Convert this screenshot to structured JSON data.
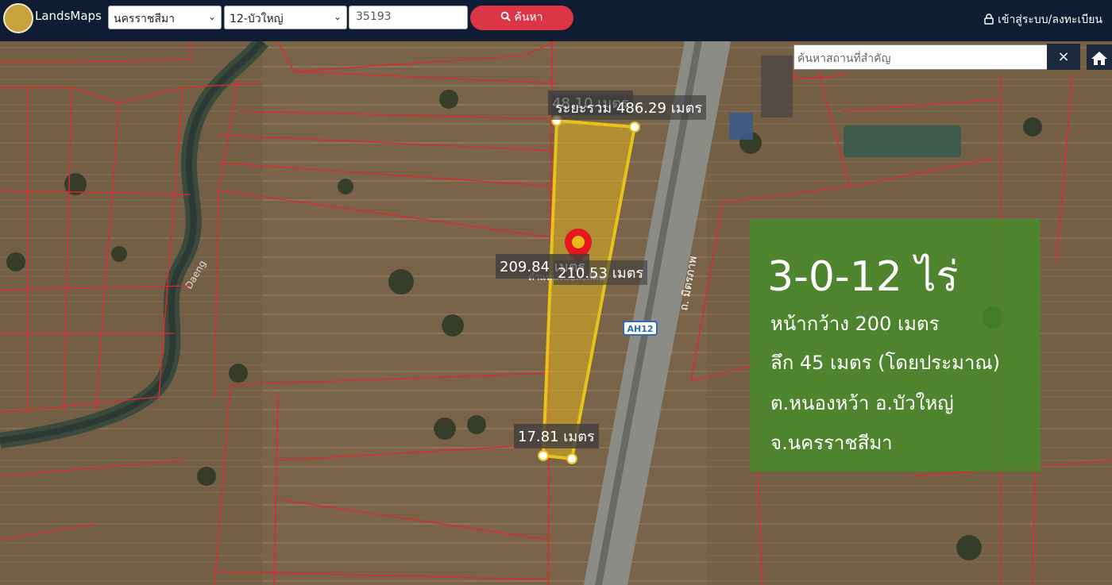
{
  "header": {
    "brand": "LandsMaps",
    "province": "นครราชสีมา",
    "district": "12-บัวใหญ่",
    "parcel_number": "35193",
    "search_label": "ค้นหา",
    "login_label": "เข้าสู่ระบบ/ลงทะเบียน"
  },
  "map": {
    "place_search_placeholder": "ค้นหาสถานที่สำคัญ",
    "close_label": "×",
    "road_label": "ถ. มิตรภาพ",
    "highway_badge": "AH12",
    "river_label": "Daeng",
    "parcel_subtitle": "ตำแหน่งแปลงที่ดิน",
    "measurements": {
      "top_edge": "48.10 เมตร",
      "perimeter": "ระยะรวม 486.29 เมตร",
      "left_edge": "209.84 เมตร",
      "right_edge": "210.53 เมตร",
      "bottom_edge": "17.81 เมตร"
    }
  },
  "info_box": {
    "area": "3-0-12 ไร่",
    "frontage": "หน้ากว้าง 200 เมตร",
    "depth": "ลึก 45 เมตร (โดยประมาณ)",
    "location": "ต.หนองหว้า อ.บัวใหญ่",
    "province": "จ.นครราชสีมา"
  },
  "colors": {
    "topbar": "#0e1d33",
    "search_button": "#dc3545",
    "parcel_outline": "#e8c21a",
    "info_box": "#468c28"
  }
}
